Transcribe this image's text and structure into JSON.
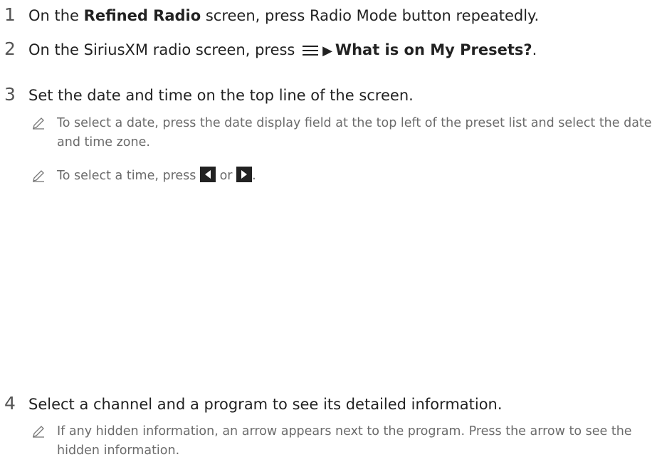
{
  "steps": [
    {
      "number": "1",
      "prefix": "On the ",
      "bold": "Refined Radio",
      "suffix": " screen, press Radio Mode button repeatedly."
    },
    {
      "number": "2",
      "prefix": "On the SiriusXM radio screen, press",
      "bold": "What is on My Presets?",
      "suffix": "."
    },
    {
      "number": "3",
      "text": "Set the date and time on the top line of the screen.",
      "notes": [
        "To select a date, press the date display field at the top left of the preset list and select the date and time zone."
      ],
      "time_note": {
        "prefix": "To select a time, press",
        "or": "or",
        "suffix": "."
      }
    },
    {
      "number": "4",
      "text": "Select a channel and a program to see its detailed information.",
      "note": "If any hidden information, an arrow appears next to the program. Press the arrow to see the hidden information."
    }
  ],
  "icons": {
    "note": "pencil-icon",
    "menu": "menu-icon",
    "prev": "left-arrow-button-icon",
    "next": "right-arrow-button-icon"
  }
}
